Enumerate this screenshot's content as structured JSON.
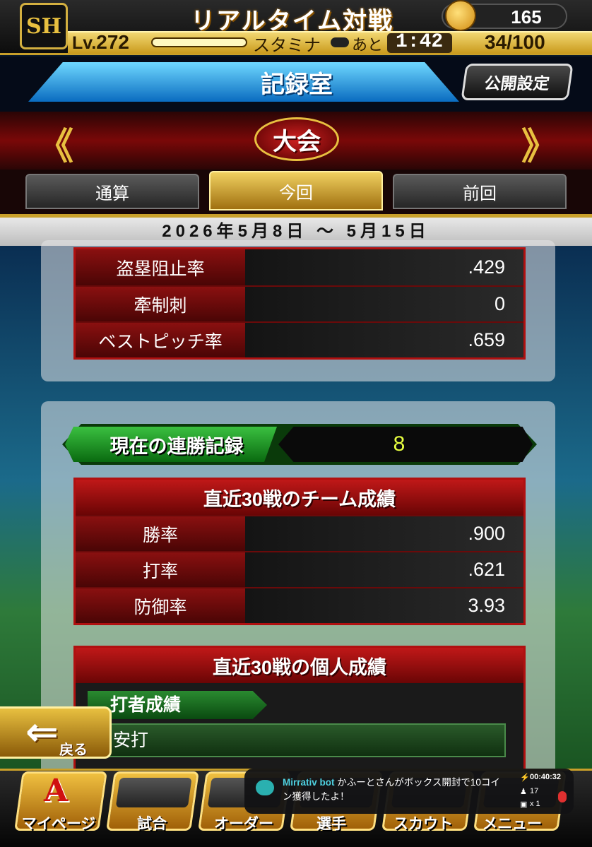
{
  "status": {
    "team_logo": "SH",
    "title": "リアルタイム対戦",
    "coins": "165",
    "level_prefix": "Lv.",
    "level": "272",
    "stamina_label": "スタミナ",
    "remaining_label": "あと",
    "timer": "1:42",
    "stamina": "34/100"
  },
  "header": {
    "title": "記録室",
    "public_settings": "公開設定"
  },
  "banner": {
    "label": "大会",
    "prev": "《",
    "next": "》"
  },
  "tabs": [
    {
      "label": "通算"
    },
    {
      "label": "今回"
    },
    {
      "label": "前回"
    }
  ],
  "date_range": "2026年5月8日 〜 5月15日",
  "pitching_stats": [
    {
      "label": "盗塁阻止率",
      "value": ".429"
    },
    {
      "label": "牽制刺",
      "value": "0"
    },
    {
      "label": "ベストピッチ率",
      "value": ".659"
    }
  ],
  "streak": {
    "label": "現在の連勝記録",
    "value": "8"
  },
  "team_record": {
    "title": "直近30戦のチーム成績",
    "rows": [
      {
        "label": "勝率",
        "value": ".900"
      },
      {
        "label": "打率",
        "value": ".621"
      },
      {
        "label": "防御率",
        "value": "3.93"
      }
    ]
  },
  "personal_record": {
    "title": "直近30戦の個人成績",
    "sub_header": "打者成績",
    "category": "安打"
  },
  "back_label": "戻る",
  "bottom_nav": [
    {
      "label": "マイページ",
      "icon": "a-emblem-icon"
    },
    {
      "label": "試合",
      "icon": "stadium-icon"
    },
    {
      "label": "オーダー",
      "icon": "bat-icon"
    },
    {
      "label": "選手",
      "icon": "player-icon"
    },
    {
      "label": "スカウト",
      "icon": "scout-icon"
    },
    {
      "label": "メニュー",
      "icon": "menu-icon"
    }
  ],
  "notification": {
    "bot": "Mirrativ bot",
    "message": "かふーとさんがボックス開封で10コイン獲得したよ！",
    "elapsed": "00:40:32",
    "viewers": "17",
    "gifts": "x 1"
  }
}
